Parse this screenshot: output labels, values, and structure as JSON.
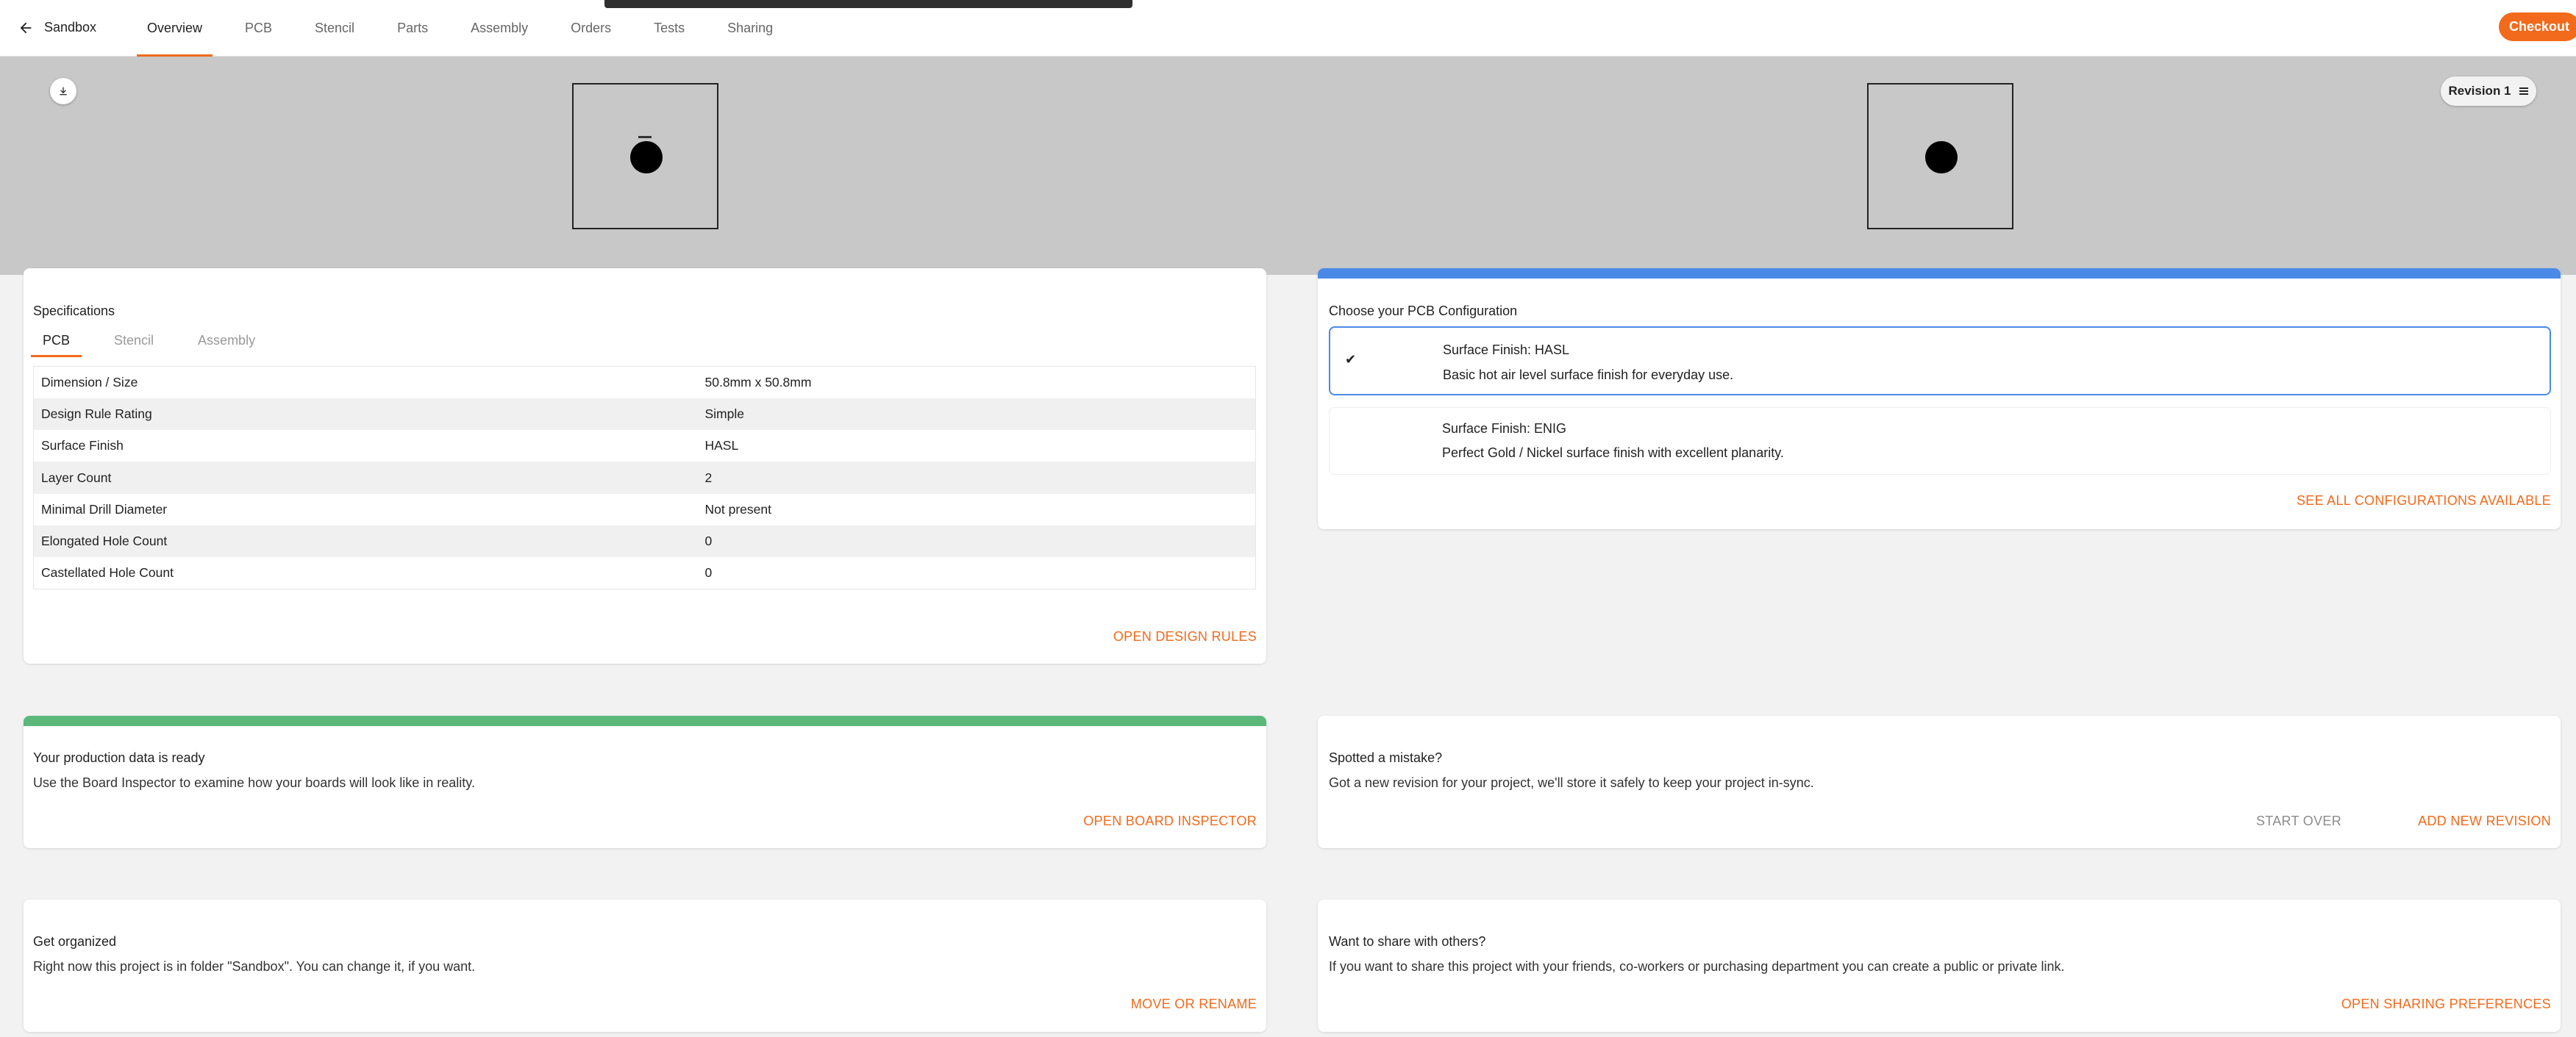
{
  "nav": {
    "back_label": "Sandbox",
    "tabs": [
      {
        "label": "Overview",
        "active": true
      },
      {
        "label": "PCB"
      },
      {
        "label": "Stencil"
      },
      {
        "label": "Parts"
      },
      {
        "label": "Assembly"
      },
      {
        "label": "Orders"
      },
      {
        "label": "Tests"
      },
      {
        "label": "Sharing"
      }
    ],
    "checkout_label": "Checkout"
  },
  "preview": {
    "download_icon": "download-icon",
    "revision_label": "Revision 1",
    "revision_icon": "list-icon"
  },
  "specifications": {
    "title": "Specifications",
    "tabs": [
      "PCB",
      "Stencil",
      "Assembly"
    ],
    "active_tab": "PCB",
    "rows": [
      {
        "key": "Dimension / Size",
        "value": "50.8mm x 50.8mm"
      },
      {
        "key": "Design Rule Rating",
        "value": "Simple"
      },
      {
        "key": "Surface Finish",
        "value": "HASL"
      },
      {
        "key": "Layer Count",
        "value": "2"
      },
      {
        "key": "Minimal Drill Diameter",
        "value": "Not present"
      },
      {
        "key": "Elongated Hole Count",
        "value": "0"
      },
      {
        "key": "Castellated Hole Count",
        "value": "0"
      }
    ],
    "action": "OPEN DESIGN RULES"
  },
  "configuration": {
    "title": "Choose your PCB Configuration",
    "accent": "#4a8ae6",
    "options": [
      {
        "title": "Surface Finish: HASL",
        "desc": "Basic hot air level surface finish for everyday use.",
        "selected": true,
        "check": "✔"
      },
      {
        "title": "Surface Finish: ENIG",
        "desc": "Perfect Gold / Nickel surface finish with excellent planarity.",
        "selected": false
      }
    ],
    "action": "SEE ALL CONFIGURATIONS AVAILABLE"
  },
  "production": {
    "accent": "#5cb87a",
    "title": "Your production data is ready",
    "text": "Use the Board Inspector to examine how your boards will look like in reality.",
    "action": "OPEN BOARD INSPECTOR"
  },
  "mistake": {
    "title": "Spotted a mistake?",
    "text": "Got a new revision for your project, we'll store it safely to keep your project in-sync.",
    "action_secondary": "START OVER",
    "action_primary": "ADD NEW REVISION"
  },
  "organize": {
    "title": "Get organized",
    "text": "Right now this project is in folder \"Sandbox\". You can change it, if you want.",
    "action": "MOVE OR RENAME"
  },
  "share": {
    "title": "Want to share with others?",
    "text": "If you want to share this project with your friends, co-workers or purchasing department you can create a public or private link.",
    "action": "OPEN SHARING PREFERENCES"
  },
  "colors": {
    "accent": "#f26a1b",
    "preview_bg": "#c8c8c8"
  }
}
